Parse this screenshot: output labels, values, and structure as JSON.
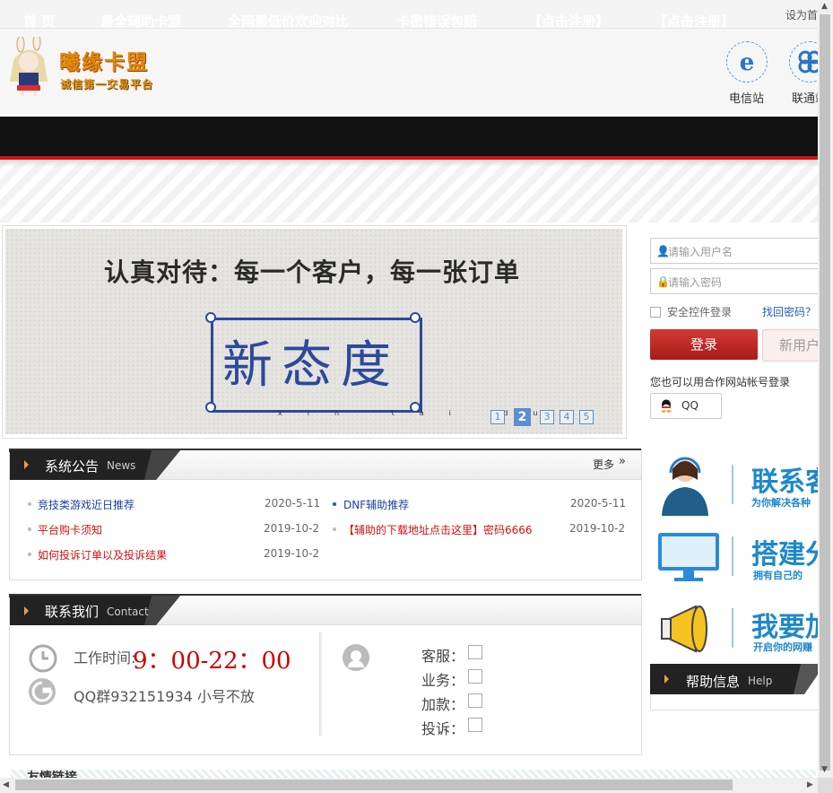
{
  "topbar": {
    "set_home": "设为首"
  },
  "logo": {
    "title": "曦缘卡盟",
    "subtitle": "诚信第一交易平台"
  },
  "carriers": [
    {
      "label": "电信站"
    },
    {
      "label": "联通站"
    }
  ],
  "nav": {
    "items": [
      "首 页",
      "最全辅助卡盟",
      "全网最低价欢迎对比",
      "卡密错误包赔",
      "【点击注册】",
      "【点击注册】"
    ]
  },
  "banner": {
    "slogan": "认真对待：每一个客户，每一张订单",
    "word": "新态度",
    "pinyin": "xin tai du",
    "pages": [
      "1",
      "2",
      "3",
      "4",
      "5"
    ],
    "active_page": 2
  },
  "login": {
    "username_placeholder": "请输入用户名",
    "password_placeholder": "请输入密码",
    "safe_login": "安全控件登录",
    "forgot": "找回密码？",
    "login_btn": "登录",
    "register_btn": "新用户",
    "partner_text": "您也可以用合作网站帐号登录",
    "qq_label": "QQ"
  },
  "news": {
    "title": "系统公告",
    "title_en": "News",
    "more": "更多",
    "items": [
      {
        "text": "竞技类游戏近日推荐",
        "date": "2020-5-11",
        "color": "#1a3fa8"
      },
      {
        "text": "DNF辅助推荐",
        "date": "2020-5-11",
        "color": "#1a3fa8"
      },
      {
        "text": "平台购卡须知",
        "date": "2019-10-2",
        "color": "#d01010"
      },
      {
        "text": "【辅助的下载地址点击这里】密码6666",
        "date": "2019-10-2",
        "color": "#d01010"
      },
      {
        "text": "如何投诉订单以及投诉结果",
        "date": "2019-10-2",
        "color": "#d01010"
      }
    ]
  },
  "contact": {
    "title": "联系我们",
    "title_en": "Contact",
    "work_label": "工作时间:",
    "work_hours": "9：00-22：00",
    "qq_group": "QQ群932151934 小号不放",
    "rows": [
      "客服：",
      "业务：",
      "加款：",
      "投诉："
    ]
  },
  "promos": [
    {
      "title": "联系客",
      "sub": "为你解决各种"
    },
    {
      "title": "搭建分",
      "sub": "拥有自己的"
    },
    {
      "title": "我要加",
      "sub": "开启你的网赚"
    }
  ],
  "help": {
    "title": "帮助信息",
    "title_en": "Help"
  },
  "friend_links": {
    "title": "友情链接"
  },
  "colors": {
    "nav_bg": "#111111",
    "nav_border": "#c8121a",
    "login_btn": "#c0282a",
    "accent_blue": "#1e88c8"
  }
}
